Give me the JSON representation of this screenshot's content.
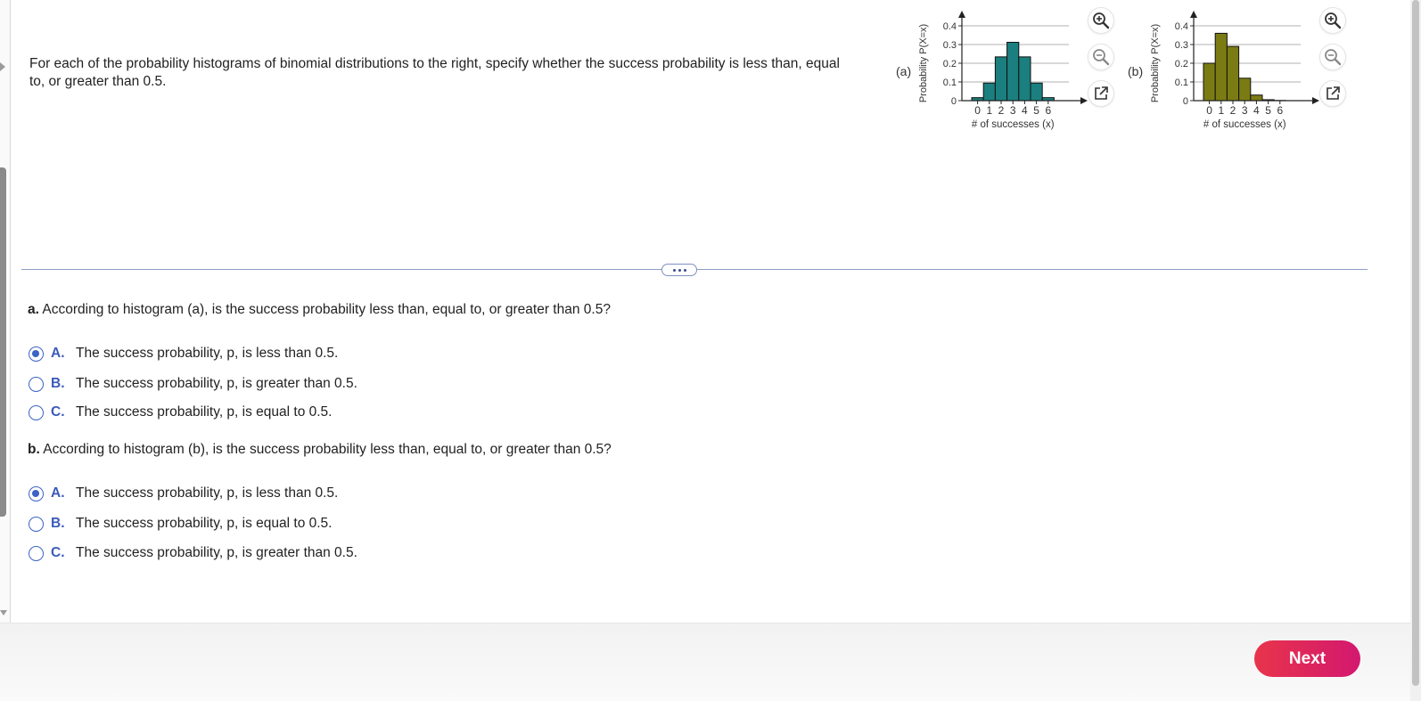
{
  "prompt": "For each of the probability histograms of binomial distributions to the right, specify whether the success probability is less than, equal to, or greater than 0.5.",
  "figures": [
    {
      "label": "(a)",
      "ylabel": "Probability P(X=x)",
      "xlabel": "# of successes (x)",
      "y_ticks": [
        "0.4",
        "0.3",
        "0.2",
        "0.1",
        "0"
      ],
      "x_ticks": [
        "0",
        "1",
        "2",
        "3",
        "4",
        "5",
        "6"
      ],
      "bar_color": "#1b7f7f"
    },
    {
      "label": "(b)",
      "ylabel": "Probability P(X=x)",
      "xlabel": "# of successes (x)",
      "y_ticks": [
        "0.4",
        "0.3",
        "0.2",
        "0.1",
        "0"
      ],
      "x_ticks": [
        "0",
        "1",
        "2",
        "3",
        "4",
        "5",
        "6"
      ],
      "bar_color": "#7b7b14"
    }
  ],
  "chart_data": [
    {
      "type": "bar",
      "categories": [
        0,
        1,
        2,
        3,
        4,
        5,
        6
      ],
      "values": [
        0.016,
        0.094,
        0.234,
        0.312,
        0.234,
        0.094,
        0.016
      ],
      "xlabel": "# of successes (x)",
      "ylabel": "Probability P(X=x)",
      "ylim": [
        0,
        0.4
      ],
      "grid": true
    },
    {
      "type": "bar",
      "categories": [
        0,
        1,
        2,
        3,
        4,
        5,
        6
      ],
      "values": [
        0.2,
        0.36,
        0.29,
        0.12,
        0.03,
        0.005,
        0.001
      ],
      "xlabel": "# of successes (x)",
      "ylabel": "Probability P(X=x)",
      "ylim": [
        0,
        0.4
      ],
      "grid": true
    }
  ],
  "tools": {
    "zoom_in": "zoom-in-icon",
    "zoom_out": "zoom-out-icon",
    "popout": "external-link-icon"
  },
  "questions": [
    {
      "letter": "a.",
      "text": " According to histogram (a), is the success probability less than, equal to, or greater than 0.5?",
      "options": [
        {
          "letter": "A.",
          "text": "The success probability, p, is less than 0.5.",
          "selected": true
        },
        {
          "letter": "B.",
          "text": "The success probability, p, is greater than 0.5.",
          "selected": false
        },
        {
          "letter": "C.",
          "text": "The success probability, p, is equal to 0.5.",
          "selected": false
        }
      ]
    },
    {
      "letter": "b.",
      "text": " According to histogram (b), is the success probability less than, equal to, or greater than 0.5?",
      "options": [
        {
          "letter": "A.",
          "text": "The success probability, p, is less than 0.5.",
          "selected": true
        },
        {
          "letter": "B.",
          "text": "The success probability, p, is equal to 0.5.",
          "selected": false
        },
        {
          "letter": "C.",
          "text": "The success probability, p, is greater than 0.5.",
          "selected": false
        }
      ]
    }
  ],
  "next_label": "Next",
  "colors": {
    "accent": "#3b64c4",
    "next_button_start": "#e8344b",
    "next_button_end": "#d3186f"
  }
}
